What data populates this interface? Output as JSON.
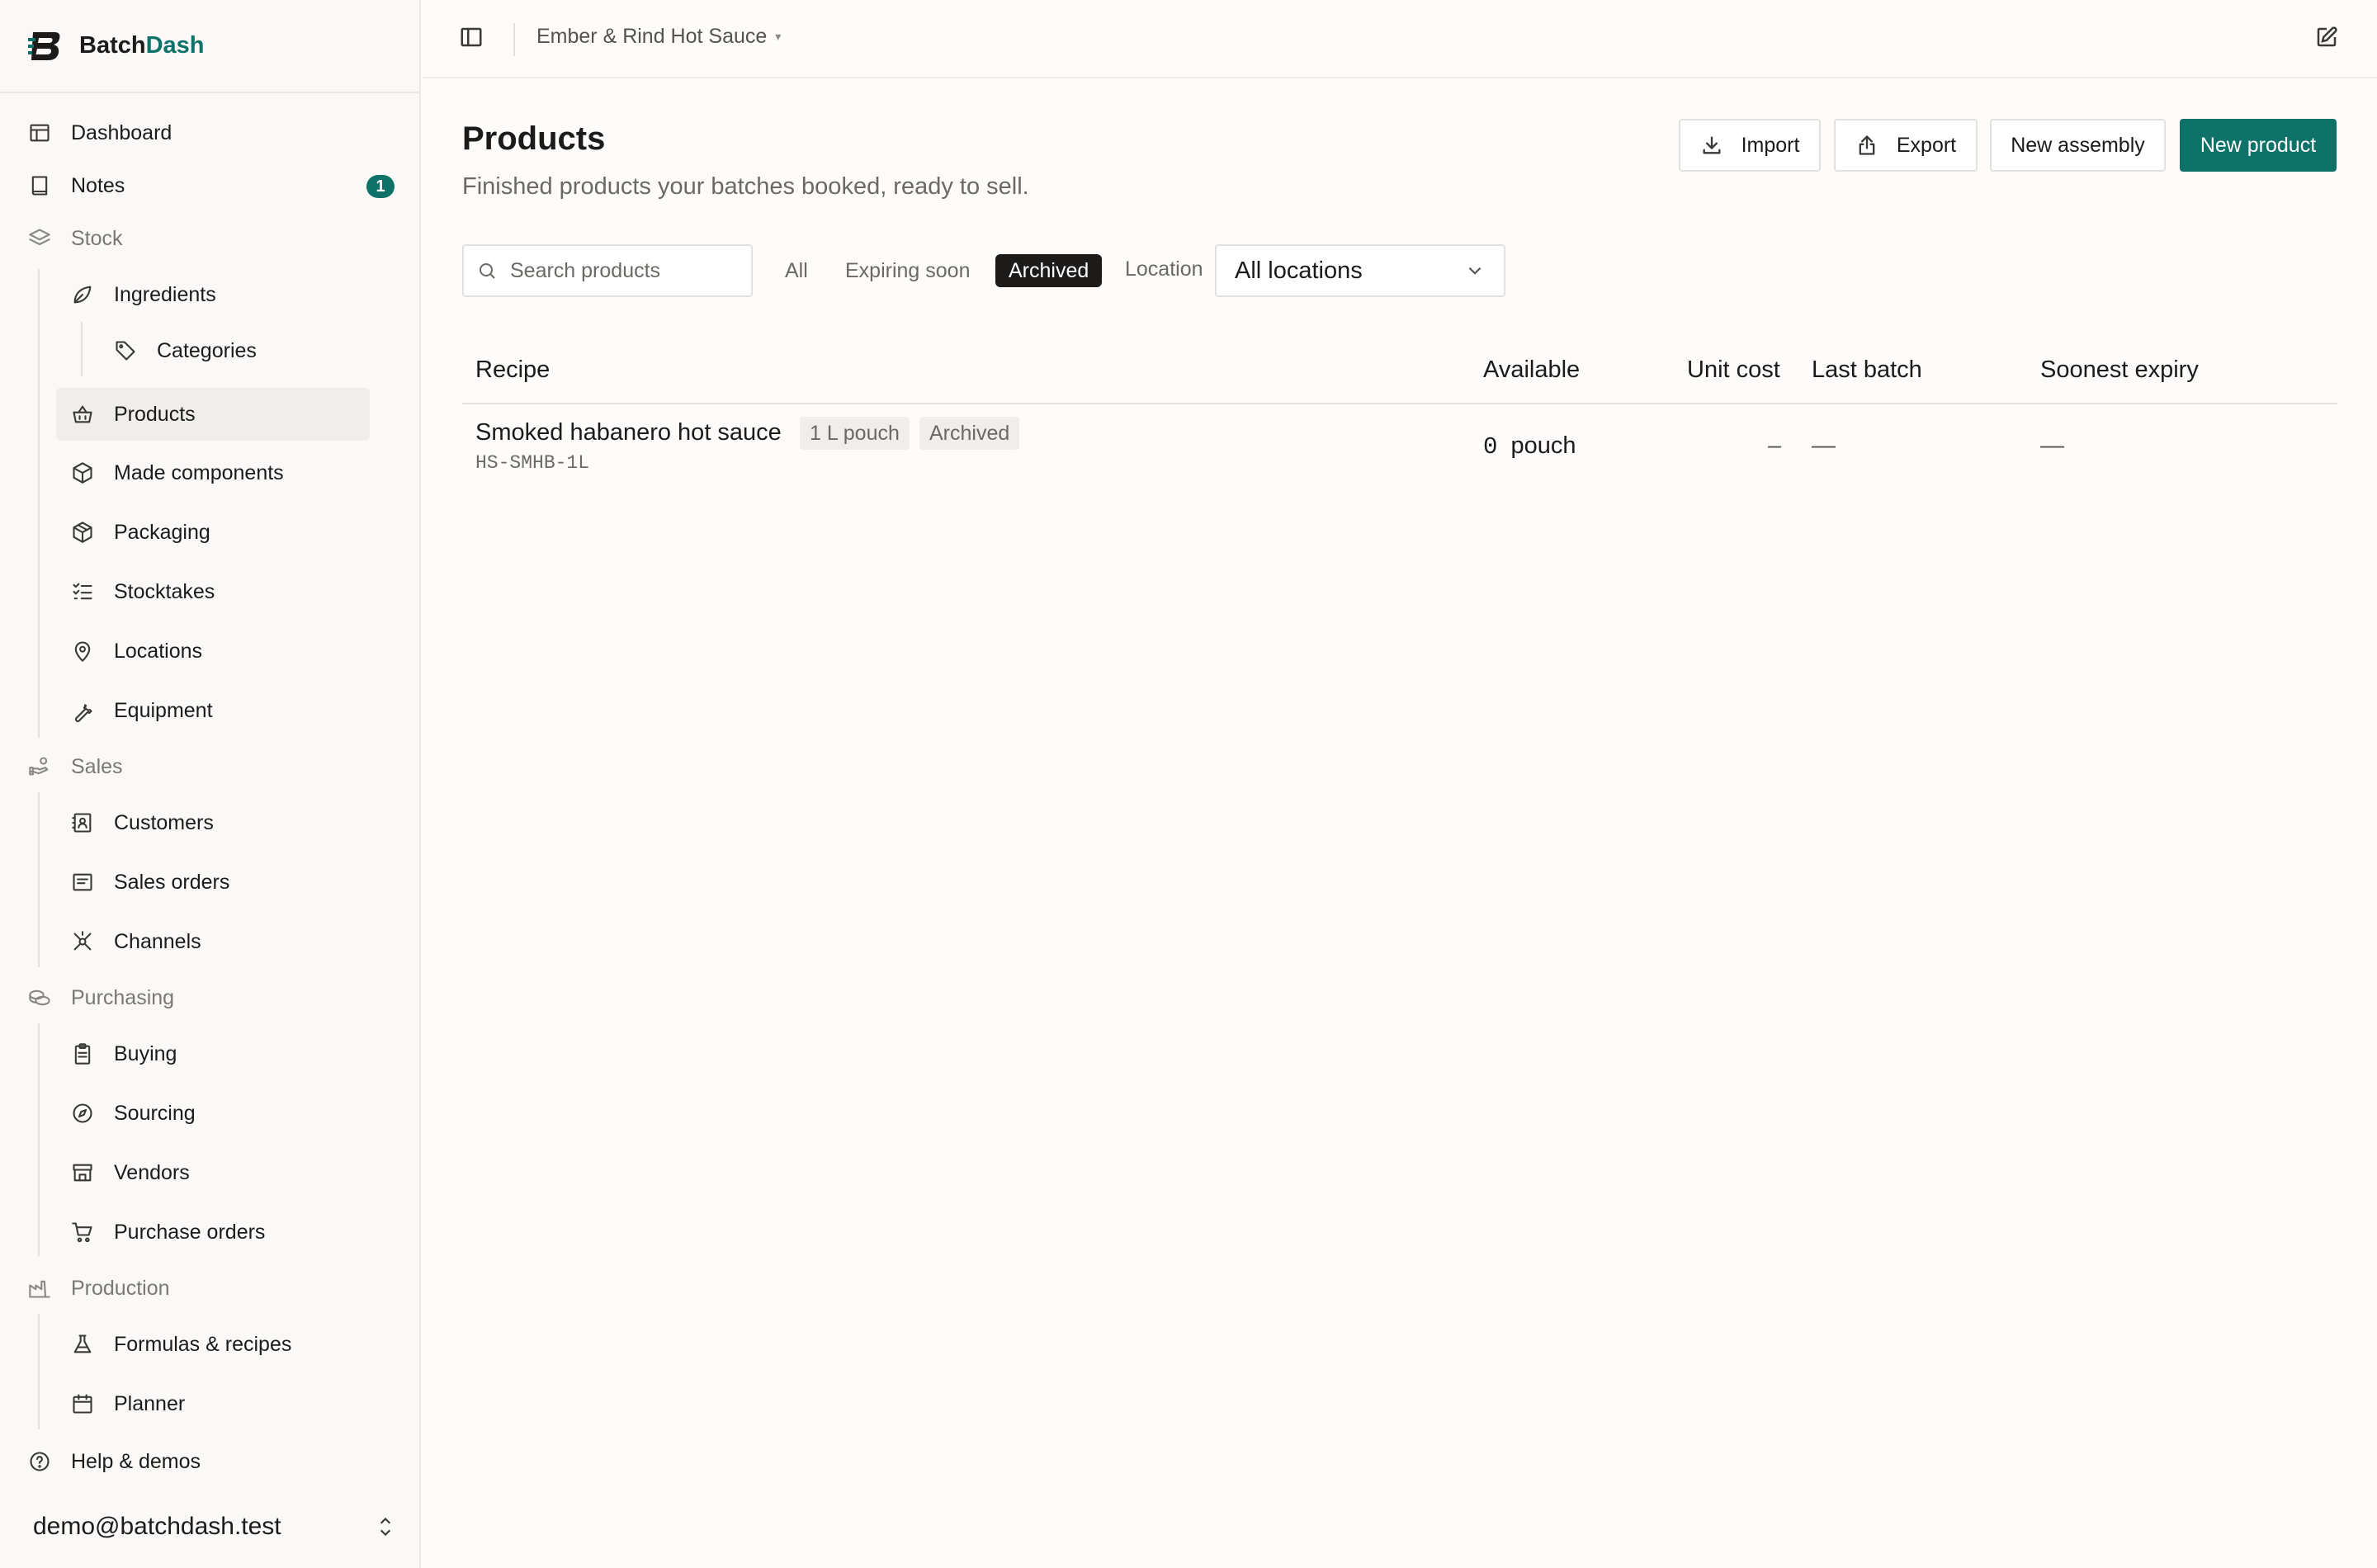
{
  "app": {
    "name_prefix": "Batch",
    "name_suffix": "Dash",
    "accent_color": "#0e7268"
  },
  "sidebar": {
    "items": [
      {
        "label": "Dashboard",
        "icon": "layout-icon"
      },
      {
        "label": "Notes",
        "icon": "notebook-icon",
        "badge": "1"
      },
      {
        "label": "Stock",
        "icon": "layers-icon",
        "section": true
      },
      {
        "label": "Ingredients",
        "icon": "leaf-icon"
      },
      {
        "label": "Categories",
        "icon": "tag-icon"
      },
      {
        "label": "Products",
        "icon": "basket-icon",
        "active": true
      },
      {
        "label": "Made components",
        "icon": "box-icon"
      },
      {
        "label": "Packaging",
        "icon": "package-icon"
      },
      {
        "label": "Stocktakes",
        "icon": "checklist-icon"
      },
      {
        "label": "Locations",
        "icon": "map-pin-icon"
      },
      {
        "label": "Equipment",
        "icon": "wrench-icon"
      },
      {
        "label": "Sales",
        "icon": "hand-coins-icon",
        "section": true
      },
      {
        "label": "Customers",
        "icon": "contact-icon"
      },
      {
        "label": "Sales orders",
        "icon": "receipt-icon"
      },
      {
        "label": "Channels",
        "icon": "network-icon"
      },
      {
        "label": "Purchasing",
        "icon": "coins-icon",
        "section": true
      },
      {
        "label": "Buying",
        "icon": "clipboard-icon"
      },
      {
        "label": "Sourcing",
        "icon": "compass-icon"
      },
      {
        "label": "Vendors",
        "icon": "store-icon"
      },
      {
        "label": "Purchase orders",
        "icon": "cart-icon"
      },
      {
        "label": "Production",
        "icon": "factory-icon",
        "section": true
      },
      {
        "label": "Formulas & recipes",
        "icon": "flask-icon"
      },
      {
        "label": "Planner",
        "icon": "calendar-icon"
      },
      {
        "label": "Help & demos",
        "icon": "help-circle-icon"
      }
    ],
    "user_email": "demo@batchdash.test"
  },
  "topbar": {
    "workspace": "Ember & Rind Hot Sauce",
    "workspace_caret": "▾"
  },
  "page": {
    "title": "Products",
    "subtitle": "Finished products your batches booked, ready to sell.",
    "actions": {
      "import": "Import",
      "export": "Export",
      "new_assembly": "New assembly",
      "new_product": "New product"
    }
  },
  "filters": {
    "search_placeholder": "Search products",
    "tabs": [
      "All",
      "Expiring soon",
      "Archived"
    ],
    "active_tab": "Archived",
    "location_label": "Location",
    "location_value": "All locations"
  },
  "table": {
    "columns": [
      "Recipe",
      "Available",
      "Unit cost",
      "Last batch",
      "Soonest expiry"
    ],
    "rows": [
      {
        "name": "Smoked habanero hot sauce",
        "size_chip": "1 L pouch",
        "status_chip": "Archived",
        "sku": "HS-SMHB-1L",
        "available_qty": "0",
        "available_unit": "pouch",
        "unit_cost": "–",
        "last_batch": "—",
        "soonest_expiry": "—"
      }
    ]
  }
}
